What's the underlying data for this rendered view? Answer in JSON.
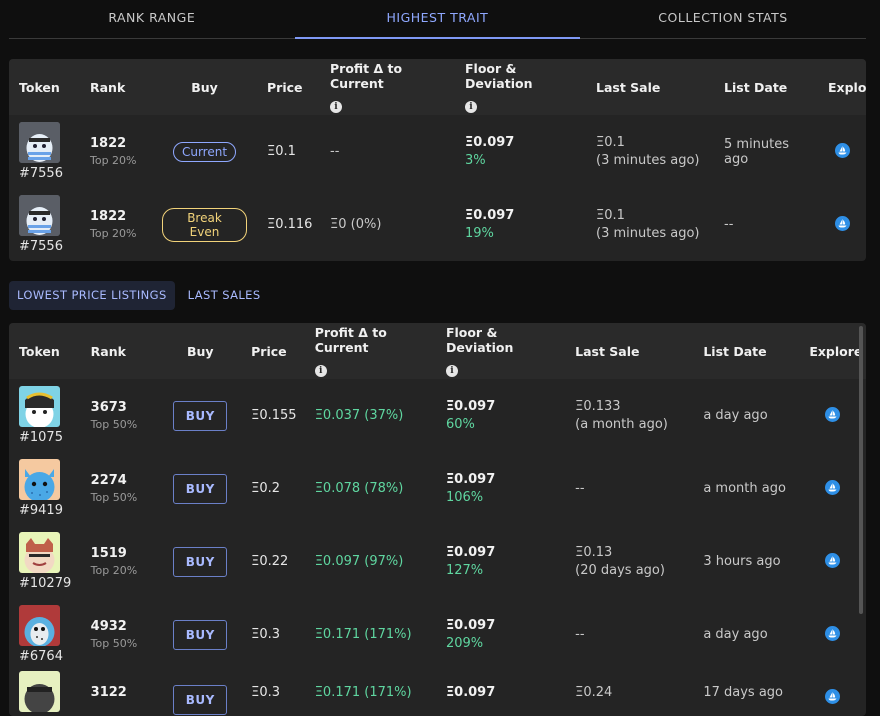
{
  "tabs": [
    {
      "label": "RANK RANGE",
      "active": false
    },
    {
      "label": "HIGHEST TRAIT",
      "active": true
    },
    {
      "label": "COLLECTION STATS",
      "active": false
    }
  ],
  "top_table": {
    "headers": {
      "token": "Token",
      "rank": "Rank",
      "buy": "Buy",
      "price": "Price",
      "profit": "Profit Δ to Current",
      "floor": "Floor & Deviation",
      "last_sale": "Last Sale",
      "list_date": "List Date",
      "explore": "Explore"
    },
    "rows": [
      {
        "token_id": "#7556",
        "rank": "1822",
        "rank_sub": "Top 20%",
        "buy": "Current",
        "price": "Ξ0.1",
        "profit": "--",
        "floor": "Ξ0.097",
        "deviation": "3%",
        "last_sale": "Ξ0.1",
        "last_sale_when": "(3 minutes ago)",
        "list_date": "5 minutes ago"
      },
      {
        "token_id": "#7556",
        "rank": "1822",
        "rank_sub": "Top 20%",
        "buy": "Break Even",
        "price": "Ξ0.116",
        "profit": "Ξ0 (0%)",
        "floor": "Ξ0.097",
        "deviation": "19%",
        "last_sale": "Ξ0.1",
        "last_sale_when": "(3 minutes ago)",
        "list_date": "--"
      }
    ]
  },
  "subtabs": [
    {
      "label": "LOWEST PRICE LISTINGS",
      "active": true
    },
    {
      "label": "LAST SALES",
      "active": false
    }
  ],
  "listings_table": {
    "headers": {
      "token": "Token",
      "rank": "Rank",
      "buy": "Buy",
      "price": "Price",
      "profit": "Profit Δ to Current",
      "floor": "Floor & Deviation",
      "last_sale": "Last Sale",
      "list_date": "List Date",
      "explore": "Explore"
    },
    "rows": [
      {
        "token_id": "#1075",
        "rank": "3673",
        "rank_sub": "Top 50%",
        "buy": "BUY",
        "price": "Ξ0.155",
        "profit": "Ξ0.037 (37%)",
        "floor": "Ξ0.097",
        "deviation": "60%",
        "last_sale": "Ξ0.133",
        "last_sale_when": "(a month ago)",
        "list_date": "a day ago",
        "avatar_bg": "#7fd3e6"
      },
      {
        "token_id": "#9419",
        "rank": "2274",
        "rank_sub": "Top 50%",
        "buy": "BUY",
        "price": "Ξ0.2",
        "profit": "Ξ0.078 (78%)",
        "floor": "Ξ0.097",
        "deviation": "106%",
        "last_sale": "--",
        "last_sale_when": "",
        "list_date": "a month ago",
        "avatar_bg": "#f5c9a0"
      },
      {
        "token_id": "#10279",
        "rank": "1519",
        "rank_sub": "Top 20%",
        "buy": "BUY",
        "price": "Ξ0.22",
        "profit": "Ξ0.097 (97%)",
        "floor": "Ξ0.097",
        "deviation": "127%",
        "last_sale": "Ξ0.13",
        "last_sale_when": "(20 days ago)",
        "list_date": "3 hours ago",
        "avatar_bg": "#e8f5b8"
      },
      {
        "token_id": "#6764",
        "rank": "4932",
        "rank_sub": "Top 50%",
        "buy": "BUY",
        "price": "Ξ0.3",
        "profit": "Ξ0.171 (171%)",
        "floor": "Ξ0.097",
        "deviation": "209%",
        "last_sale": "--",
        "last_sale_when": "",
        "list_date": "a day ago",
        "avatar_bg": "#b03a3a"
      },
      {
        "token_id": "",
        "rank": "3122",
        "rank_sub": "",
        "buy": "BUY",
        "price": "Ξ0.3",
        "profit": "Ξ0.171 (171%)",
        "floor": "Ξ0.097",
        "deviation": "",
        "last_sale": "Ξ0.24",
        "last_sale_when": "",
        "list_date": "17 days ago",
        "avatar_bg": "#e6f0c0"
      }
    ]
  },
  "colors": {
    "accent": "#8fa8ff",
    "positive": "#5fd6a0",
    "warning": "#f2d37a",
    "explore": "#2e8fe6"
  }
}
